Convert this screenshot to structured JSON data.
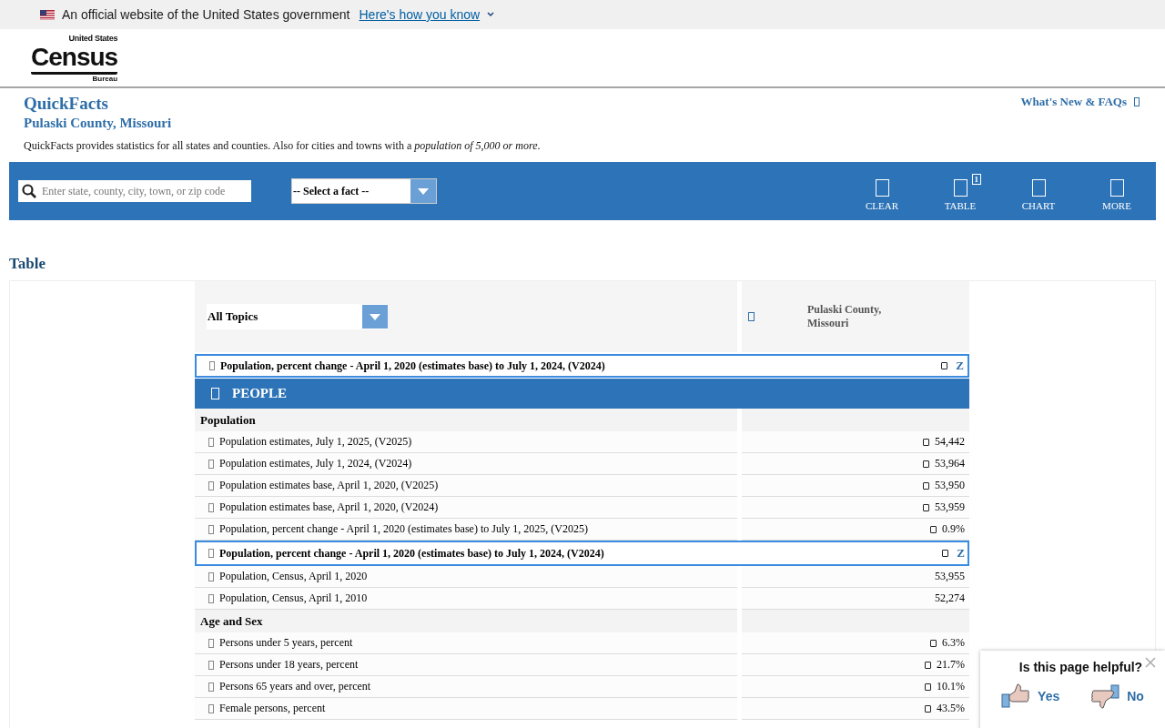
{
  "gov_banner": {
    "text": "An official website of the United States government",
    "link": "Here's how you know"
  },
  "logo": {
    "top": "United States",
    "main": "Census",
    "bottom": "Bureau"
  },
  "title": "QuickFacts",
  "subtitle": "Pulaski County, Missouri",
  "whats_new": "What's New & FAQs",
  "description": "QuickFacts provides statistics for all states and counties. Also for cities and towns with a *population of 5,000 or more*.",
  "toolbar": {
    "search_placeholder": "Enter state, county, city, town, or zip code",
    "fact_select": "-- Select a fact --",
    "actions": [
      {
        "label": "CLEAR"
      },
      {
        "label": "TABLE",
        "badge": "1"
      },
      {
        "label": "CHART"
      },
      {
        "label": "MORE"
      }
    ]
  },
  "section_title": "Table",
  "table": {
    "topic_select": "All Topics",
    "column_header": "Pulaski County, Missouri",
    "pinned_row": {
      "label": "Population, percent change - April 1, 2020 (estimates base) to July 1, 2024, (V2024)",
      "value": "Z"
    },
    "group": "PEOPLE",
    "sections": [
      {
        "title": "Population",
        "rows": [
          {
            "label": "Population estimates, July 1, 2025, (V2025)",
            "value": "54,442",
            "value_icon": true,
            "highlighted": false
          },
          {
            "label": "Population estimates, July 1, 2024, (V2024)",
            "value": "53,964",
            "value_icon": true,
            "highlighted": false
          },
          {
            "label": "Population estimates base, April 1, 2020, (V2025)",
            "value": "53,950",
            "value_icon": true,
            "highlighted": false
          },
          {
            "label": "Population estimates base, April 1, 2020, (V2024)",
            "value": "53,959",
            "value_icon": true,
            "highlighted": false
          },
          {
            "label": "Population, percent change - April 1, 2020 (estimates base) to July 1, 2025, (V2025)",
            "value": "0.9%",
            "value_icon": true,
            "highlighted": false
          },
          {
            "label": "Population, percent change - April 1, 2020 (estimates base) to July 1, 2024, (V2024)",
            "value": "Z",
            "value_icon": true,
            "highlighted": true
          },
          {
            "label": "Population, Census, April 1, 2020",
            "value": "53,955",
            "value_icon": false,
            "highlighted": false
          },
          {
            "label": "Population, Census, April 1, 2010",
            "value": "52,274",
            "value_icon": false,
            "highlighted": false
          }
        ]
      },
      {
        "title": "Age and Sex",
        "rows": [
          {
            "label": "Persons under 5 years, percent",
            "value": "6.3%",
            "value_icon": true,
            "highlighted": false
          },
          {
            "label": "Persons under 18 years, percent",
            "value": "21.7%",
            "value_icon": true,
            "highlighted": false
          },
          {
            "label": "Persons 65 years and over, percent",
            "value": "10.1%",
            "value_icon": true,
            "highlighted": false
          },
          {
            "label": "Female persons, percent",
            "value": "43.5%",
            "value_icon": true,
            "highlighted": false
          }
        ]
      }
    ]
  },
  "feedback": {
    "question": "Is this page helpful?",
    "yes": "Yes",
    "no": "No"
  }
}
